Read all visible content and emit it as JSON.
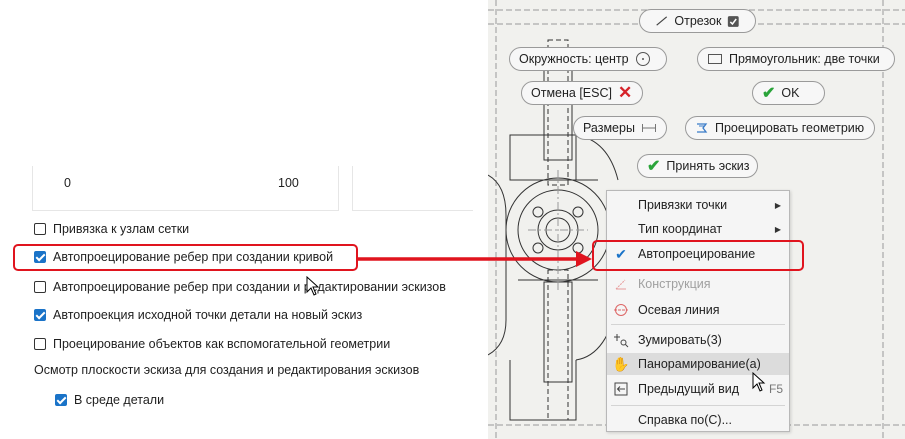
{
  "options_panel": {
    "slider_min": "0",
    "slider_max": "100",
    "options": [
      {
        "label": "Привязка к узлам сетки",
        "checked": false
      },
      {
        "label": "Автопроецирование ребер при создании кривой",
        "checked": true
      },
      {
        "label": "Автопроецирование ребер при создании и редактировании эскизов",
        "checked": false
      },
      {
        "label": "Автопроекция исходной точки детали на новый эскиз",
        "checked": true
      },
      {
        "label": "Проецирование объектов как вспомогательной геометрии",
        "checked": false
      }
    ],
    "section_label": "Осмотр плоскости эскиза для создания и редактирования эскизов",
    "sub_option": {
      "label": "В среде детали",
      "checked": true
    }
  },
  "marking_menu": {
    "line": "Отрезок",
    "circle": "Окружность: центр",
    "rectangle": "Прямоугольник: две точки",
    "cancel": "Отмена [ESC]",
    "ok": "OK",
    "dimensions": "Размеры",
    "project_geometry": "Проецировать геометрию",
    "finish_sketch": "Принять эскиз"
  },
  "context_menu": {
    "items": [
      {
        "label": "Привязки точки",
        "submenu": true
      },
      {
        "label": "Тип координат",
        "submenu": true
      },
      {
        "label": "Автопроецирование",
        "checked": true
      },
      {
        "label": "Конструкция",
        "disabled": true
      },
      {
        "label": "Осевая линия"
      },
      {
        "label": "Зумировать(3)"
      },
      {
        "label": "Панорамирование(а)",
        "hover": true
      },
      {
        "label": "Предыдущий вид",
        "shortcut": "F5"
      },
      {
        "label": "Справка по(С)..."
      }
    ]
  },
  "colors": {
    "highlight": "#e0141e",
    "checkbox_blue": "#1a73c8",
    "ok_green": "#2aa43a",
    "cancel_red": "#d6232a"
  }
}
